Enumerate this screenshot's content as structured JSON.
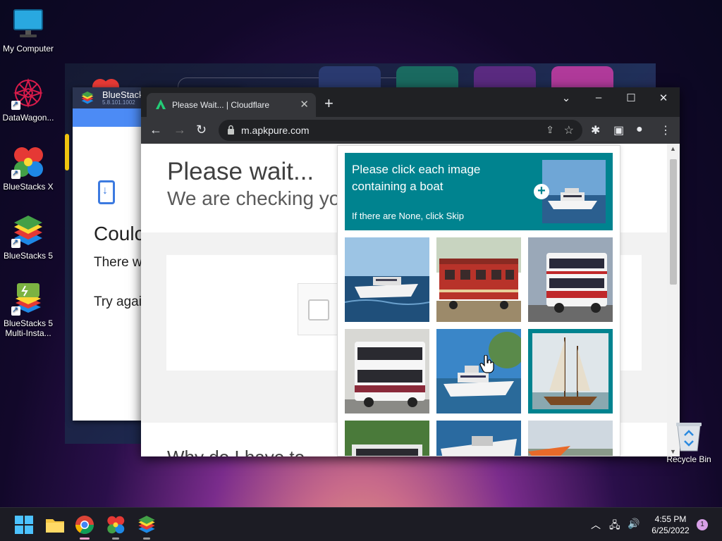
{
  "desktop": {
    "icons": [
      {
        "label": "My Computer",
        "icon": "monitor-icon"
      },
      {
        "label": "DataWagon...",
        "icon": "datawagon-icon"
      },
      {
        "label": "BlueStacks X",
        "icon": "bluestacks-x-icon"
      },
      {
        "label": "BlueStacks 5",
        "icon": "bluestacks-5-icon"
      },
      {
        "label": "BlueStacks 5 Multi-Insta...",
        "icon": "bluestacks-multi-icon"
      }
    ],
    "recycle_bin": {
      "label": "Recycle Bin",
      "icon": "recycle-bin-icon"
    }
  },
  "bluestacks5": {
    "title": "BlueStack",
    "version": "5.8.101.1002",
    "heading": "Coulc",
    "line1": "There w",
    "line2": "Try agai"
  },
  "chrome": {
    "tab_title": "Please Wait... | Cloudflare",
    "url": "m.apkpure.com",
    "page": {
      "title": "Please wait...",
      "subtitle": "We are checking yo",
      "footer_heading": "Why do I have to"
    }
  },
  "captcha": {
    "prompt": "Please click each image containing a boat",
    "skip_hint": "If there are None, click Skip",
    "images": [
      {
        "subject": "boat",
        "selected": true
      },
      {
        "subject": "train",
        "selected": false
      },
      {
        "subject": "bus",
        "selected": false
      },
      {
        "subject": "bus",
        "selected": false
      },
      {
        "subject": "boat",
        "selected": false
      },
      {
        "subject": "sailboat",
        "selected": true
      },
      {
        "subject": "bus",
        "selected": false
      },
      {
        "subject": "boat",
        "selected": false
      },
      {
        "subject": "plane",
        "selected": false
      }
    ],
    "accent": "#00838f"
  },
  "taskbar": {
    "apps": [
      "start-icon",
      "file-explorer-icon",
      "chrome-icon",
      "bluestacks-x-icon",
      "bluestacks-5-icon"
    ],
    "time": "4:55 PM",
    "date": "6/25/2022",
    "notifications": "1"
  }
}
